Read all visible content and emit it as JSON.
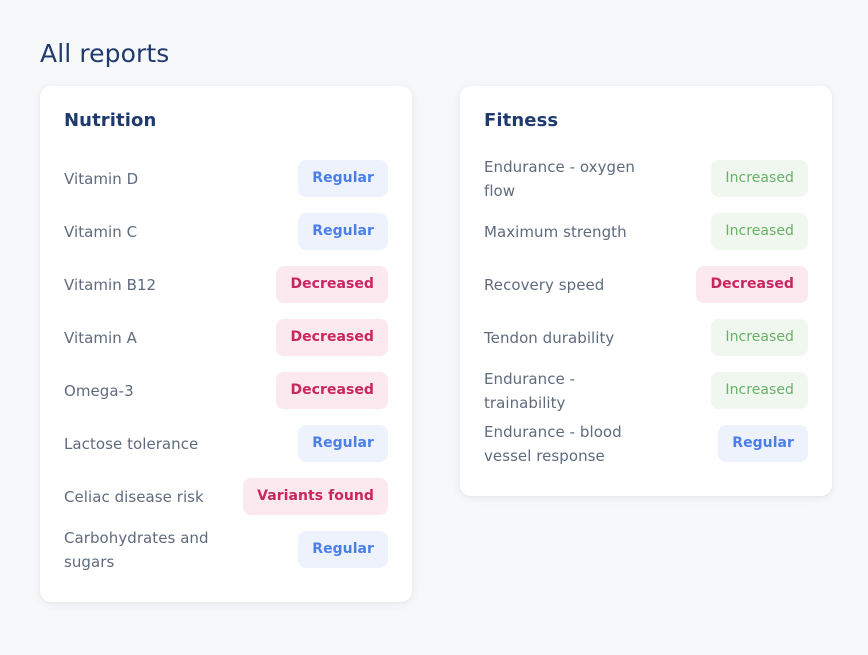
{
  "page": {
    "title": "All reports",
    "background_color": "#f7f8fa",
    "heading_color": "#1f3a6e"
  },
  "badge_styles": {
    "regular": {
      "background": "#eef2fd",
      "text_color": "#4a7fe8"
    },
    "decreased": {
      "background": "#fce9ef",
      "text_color": "#c9255e"
    },
    "increased": {
      "background": "#f0f7ee",
      "text_color": "#68b168"
    },
    "variants": {
      "background": "#fce9ef",
      "text_color": "#c9255e"
    }
  },
  "cards": [
    {
      "id": "nutrition",
      "title": "Nutrition",
      "rows": [
        {
          "label": "Vitamin D",
          "status": "Regular",
          "status_type": "regular"
        },
        {
          "label": "Vitamin C",
          "status": "Regular",
          "status_type": "regular"
        },
        {
          "label": "Vitamin B12",
          "status": "Decreased",
          "status_type": "decreased"
        },
        {
          "label": "Vitamin A",
          "status": "Decreased",
          "status_type": "decreased"
        },
        {
          "label": "Omega-3",
          "status": "Decreased",
          "status_type": "decreased"
        },
        {
          "label": "Lactose tolerance",
          "status": "Regular",
          "status_type": "regular"
        },
        {
          "label": "Celiac disease risk",
          "status": "Variants found",
          "status_type": "decreased"
        },
        {
          "label": "Carbohydrates and sugars",
          "status": "Regular",
          "status_type": "regular"
        }
      ]
    },
    {
      "id": "fitness",
      "title": "Fitness",
      "rows": [
        {
          "label": "Endurance - oxygen flow",
          "status": "Increased",
          "status_type": "increased"
        },
        {
          "label": "Maximum strength",
          "status": "Increased",
          "status_type": "increased"
        },
        {
          "label": "Recovery speed",
          "status": "Decreased",
          "status_type": "decreased"
        },
        {
          "label": "Tendon durability",
          "status": "Increased",
          "status_type": "increased"
        },
        {
          "label": "Endurance - trainability",
          "status": "Increased",
          "status_type": "increased"
        },
        {
          "label": "Endurance - blood vessel response",
          "status": "Regular",
          "status_type": "regular"
        }
      ]
    }
  ]
}
